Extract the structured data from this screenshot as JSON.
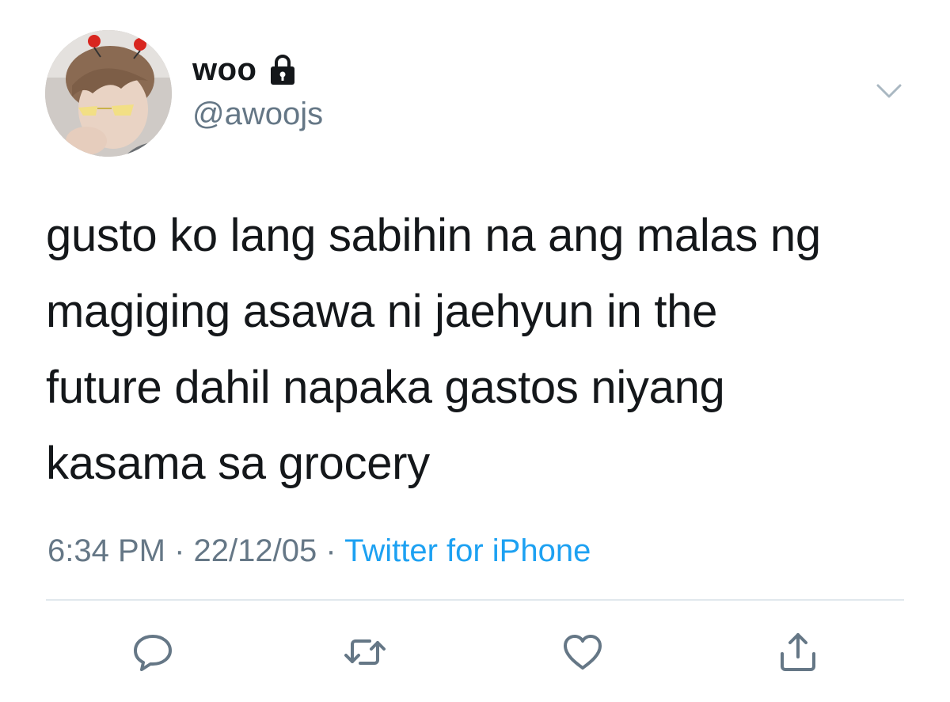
{
  "user": {
    "display_name": "woo",
    "handle": "@awoojs",
    "protected": true
  },
  "tweet": {
    "lines": [
      "gusto ko lang sabihin na ang malas ng",
      "magiging asawa ni jaehyun in the",
      "future dahil napaka gastos niyang",
      "kasama sa grocery"
    ],
    "time": "6:34 PM",
    "date": "22/12/05",
    "separator": "·",
    "source": "Twitter for iPhone"
  },
  "actions": {
    "reply_icon": "reply-icon",
    "retweet_icon": "retweet-icon",
    "like_icon": "heart-icon",
    "share_icon": "share-icon"
  },
  "colors": {
    "text": "#14171a",
    "secondary": "#657786",
    "link": "#1da1f2",
    "divider": "#e1e8ed"
  }
}
